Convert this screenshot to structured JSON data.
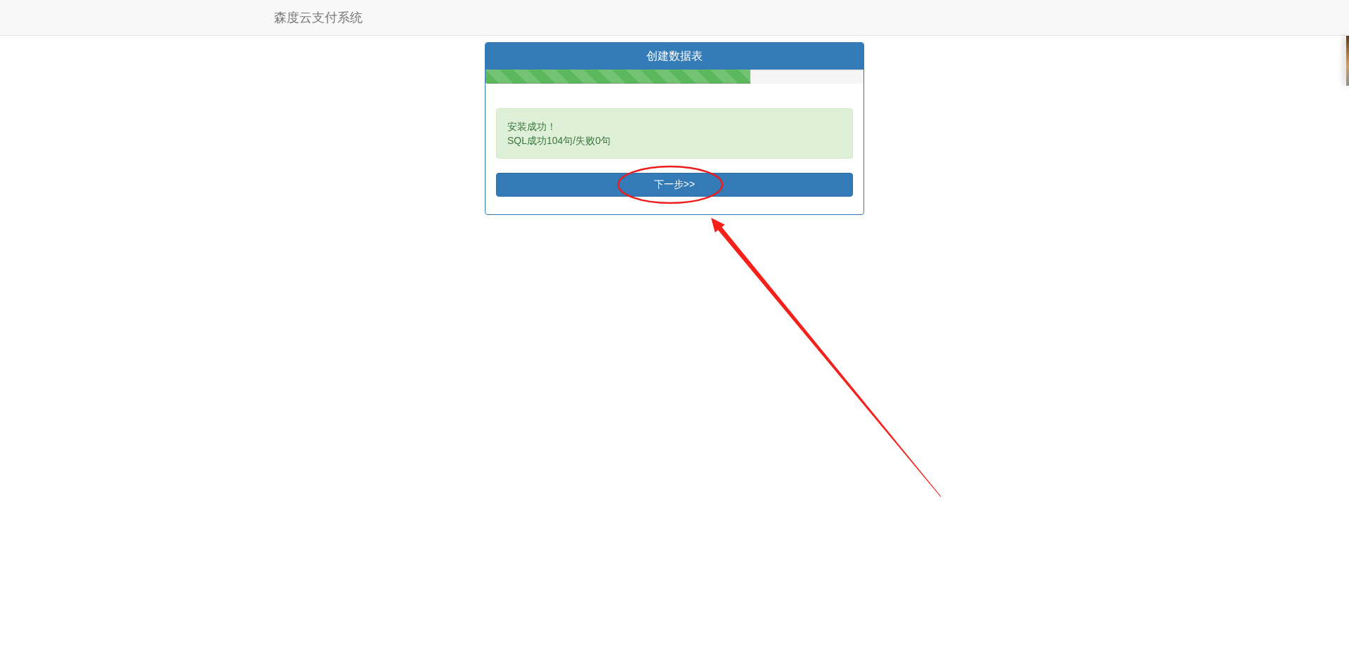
{
  "navbar": {
    "brand": "森度云支付系统"
  },
  "panel": {
    "title": "创建数据表",
    "progress": {
      "level": 0.7
    },
    "alert": {
      "lines": [
        "安装成功！",
        "SQL成功104句/失败0句"
      ]
    },
    "button": {
      "label": "下一步>>"
    }
  }
}
